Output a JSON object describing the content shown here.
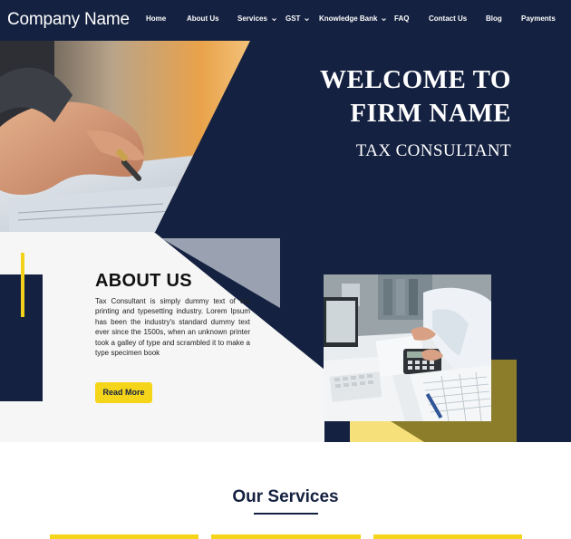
{
  "header": {
    "brand": "Company Name",
    "nav": [
      {
        "label": "Home",
        "dropdown": false
      },
      {
        "label": "About Us",
        "dropdown": false
      },
      {
        "label": "Services",
        "dropdown": true
      },
      {
        "label": "GST",
        "dropdown": true
      },
      {
        "label": "Knowledge Bank",
        "dropdown": true
      },
      {
        "label": "FAQ",
        "dropdown": false
      },
      {
        "label": "Contact Us",
        "dropdown": false
      },
      {
        "label": "Blog",
        "dropdown": false
      },
      {
        "label": "Payments",
        "dropdown": false
      }
    ]
  },
  "hero": {
    "line1": "WELCOME TO",
    "line2": "FIRM NAME",
    "line3": "TAX CONSULTANT"
  },
  "about": {
    "title": "ABOUT US",
    "text": "Tax Consultant is simply dummy text of the printing and typesetting industry. Lorem Ipsum has been the industry's standard dummy text ever since the 1500s, when an unknown printer took a galley of type and scrambled it to make a type specimen book",
    "button": "Read More"
  },
  "services": {
    "title": "Our Services"
  },
  "colors": {
    "navy": "#142140",
    "yellow": "#f5d51a",
    "olive": "#8b7d2a",
    "light_panel": "#f6f6f6",
    "gray_accent": "#9aa2b2"
  }
}
